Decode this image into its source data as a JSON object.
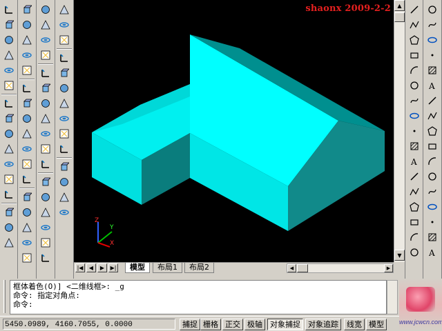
{
  "watermark": "shaonx 2009-2-2",
  "layout_tabs": [
    {
      "label": "模型",
      "active": true
    },
    {
      "label": "布局1",
      "active": false
    },
    {
      "label": "布局2",
      "active": false
    }
  ],
  "tab_nav": [
    "|◀",
    "◀",
    "▶",
    "▶|"
  ],
  "command_lines": [
    "框体着色(O)] <二维线框>: _g",
    "命令: 指定对角点:",
    "命令:"
  ],
  "coordinates": "5450.0989, 4160.7055, 0.0000",
  "status_buttons": [
    {
      "label": "捕捉",
      "on": false
    },
    {
      "label": "栅格",
      "on": false
    },
    {
      "label": "正交",
      "on": false
    },
    {
      "label": "极轴",
      "on": false
    },
    {
      "label": "对象捕捉",
      "on": true
    },
    {
      "label": "对象追踪",
      "on": false
    },
    {
      "label": "线宽",
      "on": false
    },
    {
      "label": "模型",
      "on": false
    }
  ],
  "ucs_labels": {
    "z": "Z",
    "y": "Y",
    "x": "X"
  },
  "logo_text": "www.jcwcn.com",
  "colors": {
    "model_top": "#00ffff",
    "model_mid": "#00e0e0",
    "model_dark": "#008f8f",
    "viewport_bg": "#000000",
    "watermark": "#e5201f"
  },
  "left_tools": [
    "ucs-icons",
    "3d-solids",
    "views",
    "render"
  ],
  "right_tools": [
    "line",
    "xline",
    "pline",
    "polygon",
    "rectangle",
    "arc",
    "circle",
    "revcloud",
    "spline",
    "ellipse",
    "ellipse-arc",
    "insert-block",
    "make-block",
    "point",
    "hatch",
    "region",
    "table",
    "mtext",
    "erase",
    "copy",
    "mirror",
    "offset",
    "array",
    "move",
    "rotate",
    "scale",
    "stretch",
    "trim",
    "extend",
    "break",
    "join",
    "chamfer",
    "fillet",
    "explode"
  ]
}
